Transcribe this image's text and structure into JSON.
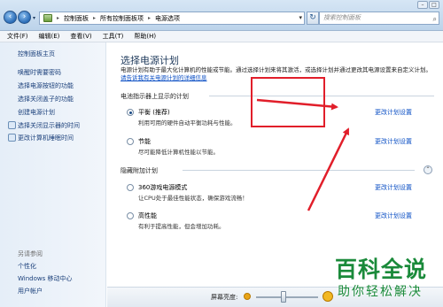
{
  "address": {
    "crumbs": [
      "控制面板",
      "所有控制面板项",
      "电源选项"
    ],
    "search_placeholder": "搜索控制面板"
  },
  "menu": [
    "文件(F)",
    "编辑(E)",
    "查看(V)",
    "工具(T)",
    "帮助(H)"
  ],
  "sidebar": {
    "items": [
      {
        "label": "控制面板主页"
      },
      {
        "label": "唤醒时需要密码"
      },
      {
        "label": "选择电源按钮的功能"
      },
      {
        "label": "选择关闭盖子的功能"
      },
      {
        "label": "创建电源计划"
      },
      {
        "label": "选择关闭显示器的时间"
      },
      {
        "label": "更改计算机睡眠时间"
      }
    ],
    "see_also_title": "另请参阅",
    "see_also_items": [
      {
        "label": "个性化"
      },
      {
        "label": "Windows 移动中心"
      },
      {
        "label": "用户帐户"
      }
    ]
  },
  "main": {
    "title": "选择电源计划",
    "description": "电源计划有助于最大化计算机的性能或节能。通过选择计划来将其激活，或选择计划并通过更改其电源设置来自定义计划。",
    "description_link": "请告诉我有关电源计划的详细信息",
    "group1_title": "电池指示器上显示的计划",
    "group2_title": "隐藏附加计划",
    "plans": [
      {
        "name": "平衡 (推荐)",
        "desc": "利用可用的硬件自动平衡功耗与性能。",
        "link": "更改计划设置",
        "selected": true
      },
      {
        "name": "节能",
        "desc": "尽可能降低计算机性能以节能。",
        "link": "更改计划设置",
        "selected": false
      },
      {
        "name": "360游戏电源模式",
        "desc": "让CPU处于最佳性能状态，确保游戏流畅！",
        "link": "更改计划设置",
        "selected": false
      },
      {
        "name": "高性能",
        "desc": "有利于提高性能，但会增加功耗。",
        "link": "更改计划设置",
        "selected": false
      }
    ],
    "brightness_label": "屏幕亮度:"
  },
  "watermark": {
    "main": "百科全说",
    "sub": "助你轻松解决"
  },
  "colors": {
    "link": "#0a4ec4",
    "annotation": "#e11e2a",
    "watermark": "#1a8a3a"
  }
}
